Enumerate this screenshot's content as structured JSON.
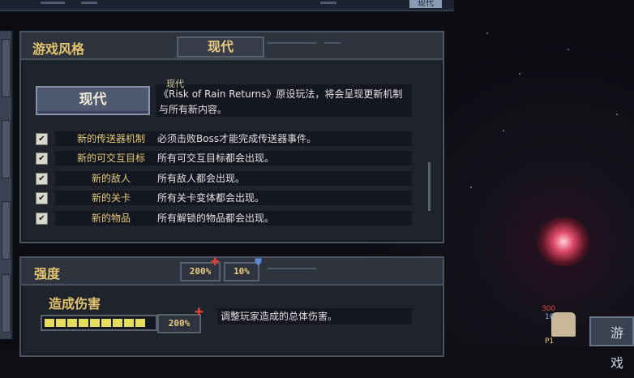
{
  "top": {
    "tab_label": "现代"
  },
  "game_style": {
    "header_label": "游戏风格",
    "selected_style": "现代",
    "big_button_label": "现代",
    "description_title": "现代",
    "description": "《Risk of Rain Returns》原设玩法，将会呈现更新机制与所有新内容。",
    "rows": [
      {
        "label": "新的传送器机制",
        "desc": "必须击败Boss才能完成传送器事件。",
        "checked": true
      },
      {
        "label": "新的可交互目标",
        "desc": "所有可交互目标都会出现。",
        "checked": true
      },
      {
        "label": "新的敌人",
        "desc": "所有敌人都会出现。",
        "checked": true
      },
      {
        "label": "新的关卡",
        "desc": "所有关卡变体都会出现。",
        "checked": true
      },
      {
        "label": "新的物品",
        "desc": "所有解锁的物品都会出现。",
        "checked": true
      }
    ],
    "check_glyph": "✔"
  },
  "intensity": {
    "header_label": "强度",
    "damage_pct": "200%",
    "shield_pct": "10%",
    "damage_label": "造成伤害",
    "damage_value": "200%",
    "damage_desc": "调整玩家造成的总体伤害。",
    "bar_segments_filled": 9,
    "bar_segments_total": 10
  },
  "game_button": {
    "label": "游戏"
  },
  "hud": {
    "value_a": "300",
    "value_b": "10",
    "player": "P1"
  },
  "colors": {
    "accent_gold": "#e2c36e",
    "checkbox": "#d8d8cc",
    "bar_fill": "#e7dd5c",
    "damage_red": "#d9413d",
    "shield_blue": "#5c8ad8"
  }
}
